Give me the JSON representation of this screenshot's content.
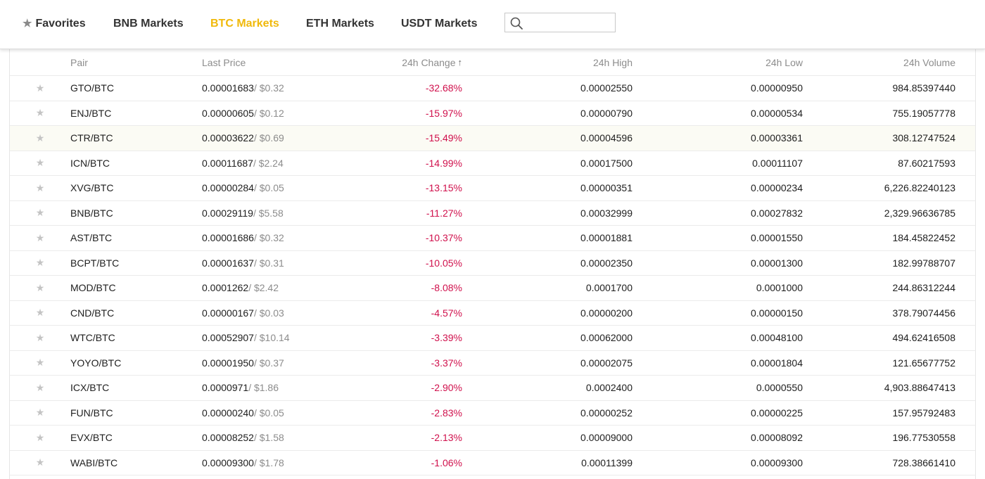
{
  "tabs": {
    "favorites": "Favorites",
    "bnb": "BNB Markets",
    "btc": "BTC Markets",
    "eth": "ETH Markets",
    "usdt": "USDT Markets",
    "active": "BTC Markets",
    "accent_color": "#f0b90b",
    "icons": {
      "favorites": "star-icon",
      "search": "search-icon"
    }
  },
  "search": {
    "value": "",
    "placeholder": ""
  },
  "table": {
    "headers": {
      "pair": "Pair",
      "last_price": "Last Price",
      "change": "24h Change",
      "high": "24h High",
      "low": "24h Low",
      "volume": "24h Volume"
    },
    "sort_indicator": "↑",
    "negative_color": "#d0104c",
    "rows": [
      {
        "pair": "GTO/BTC",
        "last": "0.00001683",
        "usd": " / $0.32",
        "change": "-32.68%",
        "high": "0.00002550",
        "low": "0.00000950",
        "volume": "984.85397440"
      },
      {
        "pair": "ENJ/BTC",
        "last": "0.00000605",
        "usd": " / $0.12",
        "change": "-15.97%",
        "high": "0.00000790",
        "low": "0.00000534",
        "volume": "755.19057778"
      },
      {
        "pair": "CTR/BTC",
        "last": "0.00003622",
        "usd": " / $0.69",
        "change": "-15.49%",
        "high": "0.00004596",
        "low": "0.00003361",
        "volume": "308.12747524"
      },
      {
        "pair": "ICN/BTC",
        "last": "0.00011687",
        "usd": " / $2.24",
        "change": "-14.99%",
        "high": "0.00017500",
        "low": "0.00011107",
        "volume": "87.60217593"
      },
      {
        "pair": "XVG/BTC",
        "last": "0.00000284",
        "usd": " / $0.05",
        "change": "-13.15%",
        "high": "0.00000351",
        "low": "0.00000234",
        "volume": "6,226.82240123"
      },
      {
        "pair": "BNB/BTC",
        "last": "0.00029119",
        "usd": " / $5.58",
        "change": "-11.27%",
        "high": "0.00032999",
        "low": "0.00027832",
        "volume": "2,329.96636785"
      },
      {
        "pair": "AST/BTC",
        "last": "0.00001686",
        "usd": " / $0.32",
        "change": "-10.37%",
        "high": "0.00001881",
        "low": "0.00001550",
        "volume": "184.45822452"
      },
      {
        "pair": "BCPT/BTC",
        "last": "0.00001637",
        "usd": " / $0.31",
        "change": "-10.05%",
        "high": "0.00002350",
        "low": "0.00001300",
        "volume": "182.99788707"
      },
      {
        "pair": "MOD/BTC",
        "last": "0.0001262",
        "usd": " / $2.42",
        "change": "-8.08%",
        "high": "0.0001700",
        "low": "0.0001000",
        "volume": "244.86312244"
      },
      {
        "pair": "CND/BTC",
        "last": "0.00000167",
        "usd": " / $0.03",
        "change": "-4.57%",
        "high": "0.00000200",
        "low": "0.00000150",
        "volume": "378.79074456"
      },
      {
        "pair": "WTC/BTC",
        "last": "0.00052907",
        "usd": " / $10.14",
        "change": "-3.39%",
        "high": "0.00062000",
        "low": "0.00048100",
        "volume": "494.62416508"
      },
      {
        "pair": "YOYO/BTC",
        "last": "0.00001950",
        "usd": " / $0.37",
        "change": "-3.37%",
        "high": "0.00002075",
        "low": "0.00001804",
        "volume": "121.65677752"
      },
      {
        "pair": "ICX/BTC",
        "last": "0.0000971",
        "usd": " / $1.86",
        "change": "-2.90%",
        "high": "0.0002400",
        "low": "0.0000550",
        "volume": "4,903.88647413"
      },
      {
        "pair": "FUN/BTC",
        "last": "0.00000240",
        "usd": " / $0.05",
        "change": "-2.83%",
        "high": "0.00000252",
        "low": "0.00000225",
        "volume": "157.95792483"
      },
      {
        "pair": "EVX/BTC",
        "last": "0.00008252",
        "usd": " / $1.58",
        "change": "-2.13%",
        "high": "0.00009000",
        "low": "0.00008092",
        "volume": "196.77530558"
      },
      {
        "pair": "WABI/BTC",
        "last": "0.00009300",
        "usd": " / $1.78",
        "change": "-1.06%",
        "high": "0.00011399",
        "low": "0.00009300",
        "volume": "728.38661410"
      }
    ]
  }
}
